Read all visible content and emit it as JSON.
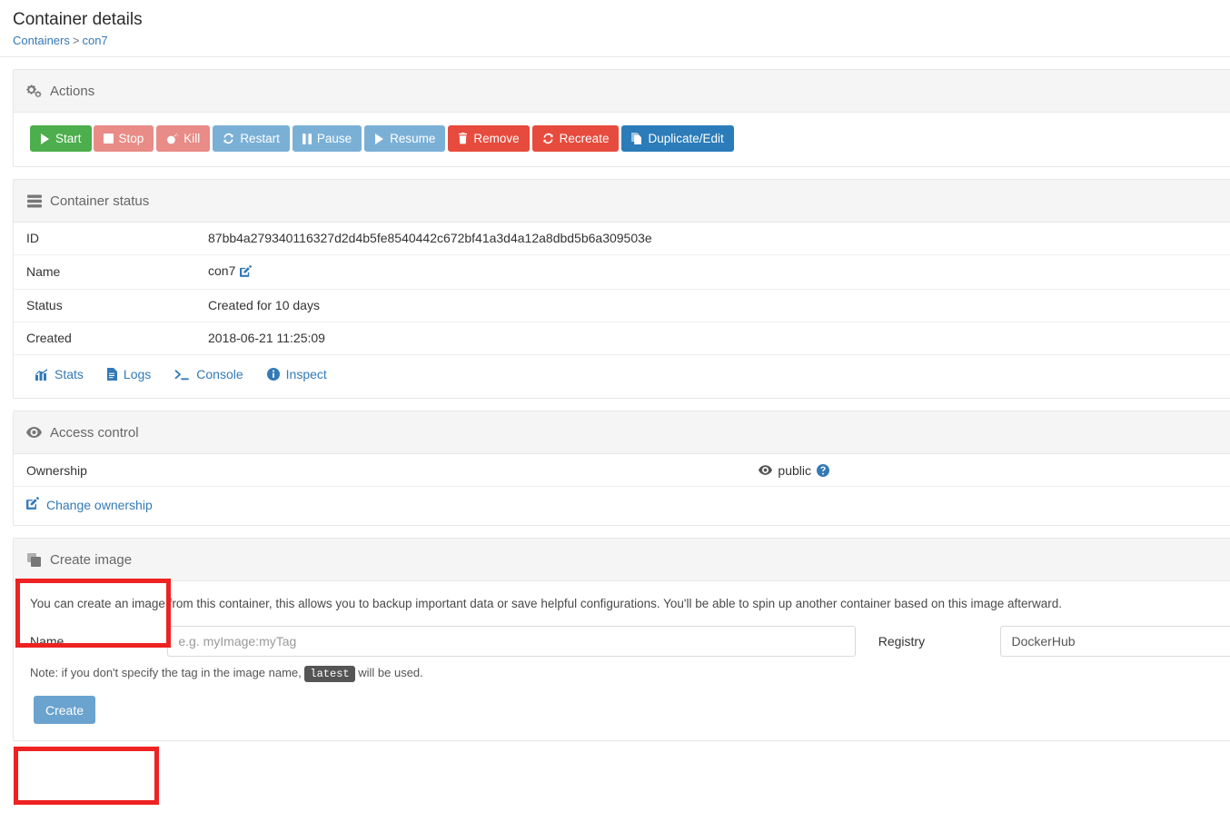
{
  "header": {
    "title": "Container details",
    "breadcrumb": {
      "root": "Containers",
      "separator": ">",
      "current": "con7"
    }
  },
  "actions_panel": {
    "heading": "Actions",
    "heading_icon": "gears-icon",
    "buttons": [
      {
        "label": "Start",
        "icon": "play-icon",
        "color": "#4cae4c"
      },
      {
        "label": "Stop",
        "icon": "stop-icon",
        "color": "#e98b87"
      },
      {
        "label": "Kill",
        "icon": "bomb-icon",
        "color": "#e98b87"
      },
      {
        "label": "Restart",
        "icon": "refresh-icon",
        "color": "#7bb0d6"
      },
      {
        "label": "Pause",
        "icon": "pause-icon",
        "color": "#7bb0d6"
      },
      {
        "label": "Resume",
        "icon": "play-icon",
        "color": "#7bb0d6"
      },
      {
        "label": "Remove",
        "icon": "trash-icon",
        "color": "#e64b3d"
      },
      {
        "label": "Recreate",
        "icon": "refresh-icon",
        "color": "#e64b3d"
      },
      {
        "label": "Duplicate/Edit",
        "icon": "copy-icon",
        "color": "#2b7cb9"
      }
    ]
  },
  "status_panel": {
    "heading": "Container status",
    "heading_icon": "server-icon",
    "rows": [
      {
        "key": "ID",
        "value": "87bb4a279340116327d2d4b5fe8540442c672bf41a3d4a12a8dbd5b6a309503e"
      },
      {
        "key": "Name",
        "value": "con7"
      },
      {
        "key": "Status",
        "value": "Created for 10 days"
      },
      {
        "key": "Created",
        "value": "2018-06-21 11:25:09"
      }
    ],
    "name_edit_icon": "pencil-square-icon",
    "links": [
      {
        "label": "Stats",
        "icon": "chart-icon"
      },
      {
        "label": "Logs",
        "icon": "file-text-icon"
      },
      {
        "label": "Console",
        "icon": "terminal-icon"
      },
      {
        "label": "Inspect",
        "icon": "info-circle-icon"
      }
    ]
  },
  "access_panel": {
    "heading": "Access control",
    "heading_icon": "eye-icon",
    "ownership_label": "Ownership",
    "ownership_value": "public",
    "ownership_value_icon": "eye-icon",
    "help_icon": "question-circle-icon",
    "change_ownership_label": "Change ownership",
    "change_ownership_icon": "pencil-square-icon"
  },
  "create_image_panel": {
    "heading": "Create image",
    "heading_icon": "clone-icon",
    "description": "You can create an image from this container, this allows you to backup important data or save helpful configurations. You'll be able to spin up another container based on this image afterward.",
    "name_label": "Name",
    "name_placeholder": "e.g. myImage:myTag",
    "name_value": "",
    "registry_label": "Registry",
    "registry_value": "DockerHub",
    "note_prefix": "Note: if you don't specify the tag in the image name,",
    "note_code": "latest",
    "note_suffix": "will be used.",
    "create_button_label": "Create"
  },
  "annotations": {
    "highlight_color": "#ee2222",
    "boxes": [
      {
        "name": "create-image-heading-highlight"
      },
      {
        "name": "create-button-highlight"
      }
    ]
  }
}
